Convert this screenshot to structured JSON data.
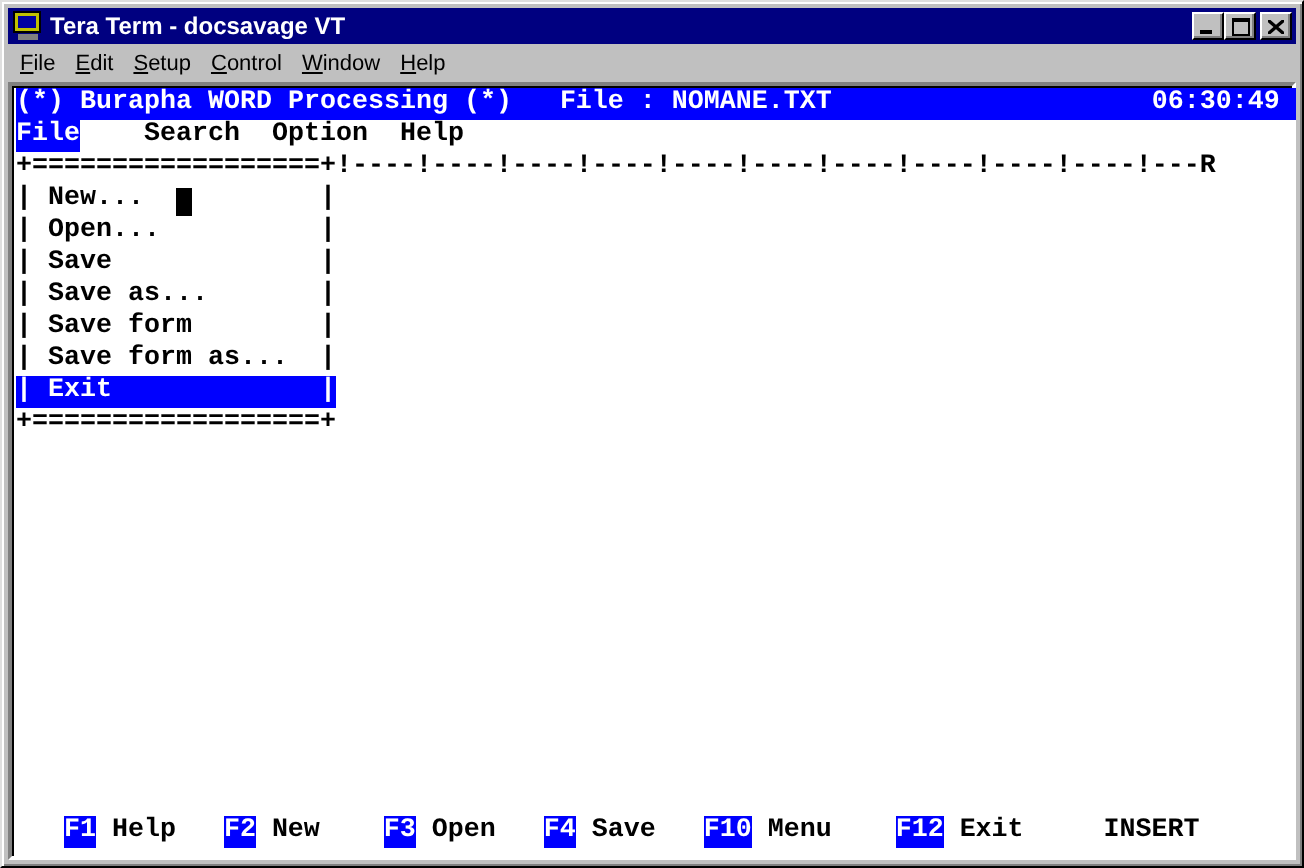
{
  "window": {
    "title": "Tera Term - docsavage VT"
  },
  "menubar": [
    {
      "label": "File"
    },
    {
      "label": "Edit"
    },
    {
      "label": "Setup"
    },
    {
      "label": "Control"
    },
    {
      "label": "Window"
    },
    {
      "label": "Help"
    }
  ],
  "terminal": {
    "header": {
      "title": "(*) Burapha WORD Processing (*)",
      "file": "File : NOMANE.TXT",
      "clock": "06:30:49"
    },
    "app_menu": [
      {
        "label": "File",
        "selected": true
      },
      {
        "label": "Search",
        "selected": false
      },
      {
        "label": "Option",
        "selected": false
      },
      {
        "label": "Help",
        "selected": false
      }
    ],
    "ruler": {
      "border": "+==================+",
      "scale": "!----!----!----!----!----!----!----!----!----!----!---R"
    },
    "dropdown": [
      {
        "left": "|",
        "label": "New...",
        "cursor": true,
        "right": "|",
        "selected": false
      },
      {
        "left": "|",
        "label": "Open...",
        "cursor": false,
        "right": "|",
        "selected": false
      },
      {
        "left": "|",
        "label": "Save",
        "cursor": false,
        "right": "|",
        "selected": false
      },
      {
        "left": "|",
        "label": "Save as...",
        "cursor": false,
        "right": "|",
        "selected": false
      },
      {
        "left": "|",
        "label": "Save form",
        "cursor": false,
        "right": "|",
        "selected": false
      },
      {
        "left": "|",
        "label": "Save form as...",
        "cursor": false,
        "right": "|",
        "selected": false
      },
      {
        "left": "|",
        "label": "Exit",
        "cursor": false,
        "right": "|",
        "selected": true
      }
    ],
    "bottom_border": "+==================+",
    "function_keys": [
      {
        "key": "F1",
        "label": "Help"
      },
      {
        "key": "F2",
        "label": "New"
      },
      {
        "key": "F3",
        "label": "Open"
      },
      {
        "key": "F4",
        "label": "Save"
      },
      {
        "key": "F10",
        "label": "Menu"
      },
      {
        "key": "F12",
        "label": "Exit"
      }
    ],
    "mode": "INSERT"
  }
}
